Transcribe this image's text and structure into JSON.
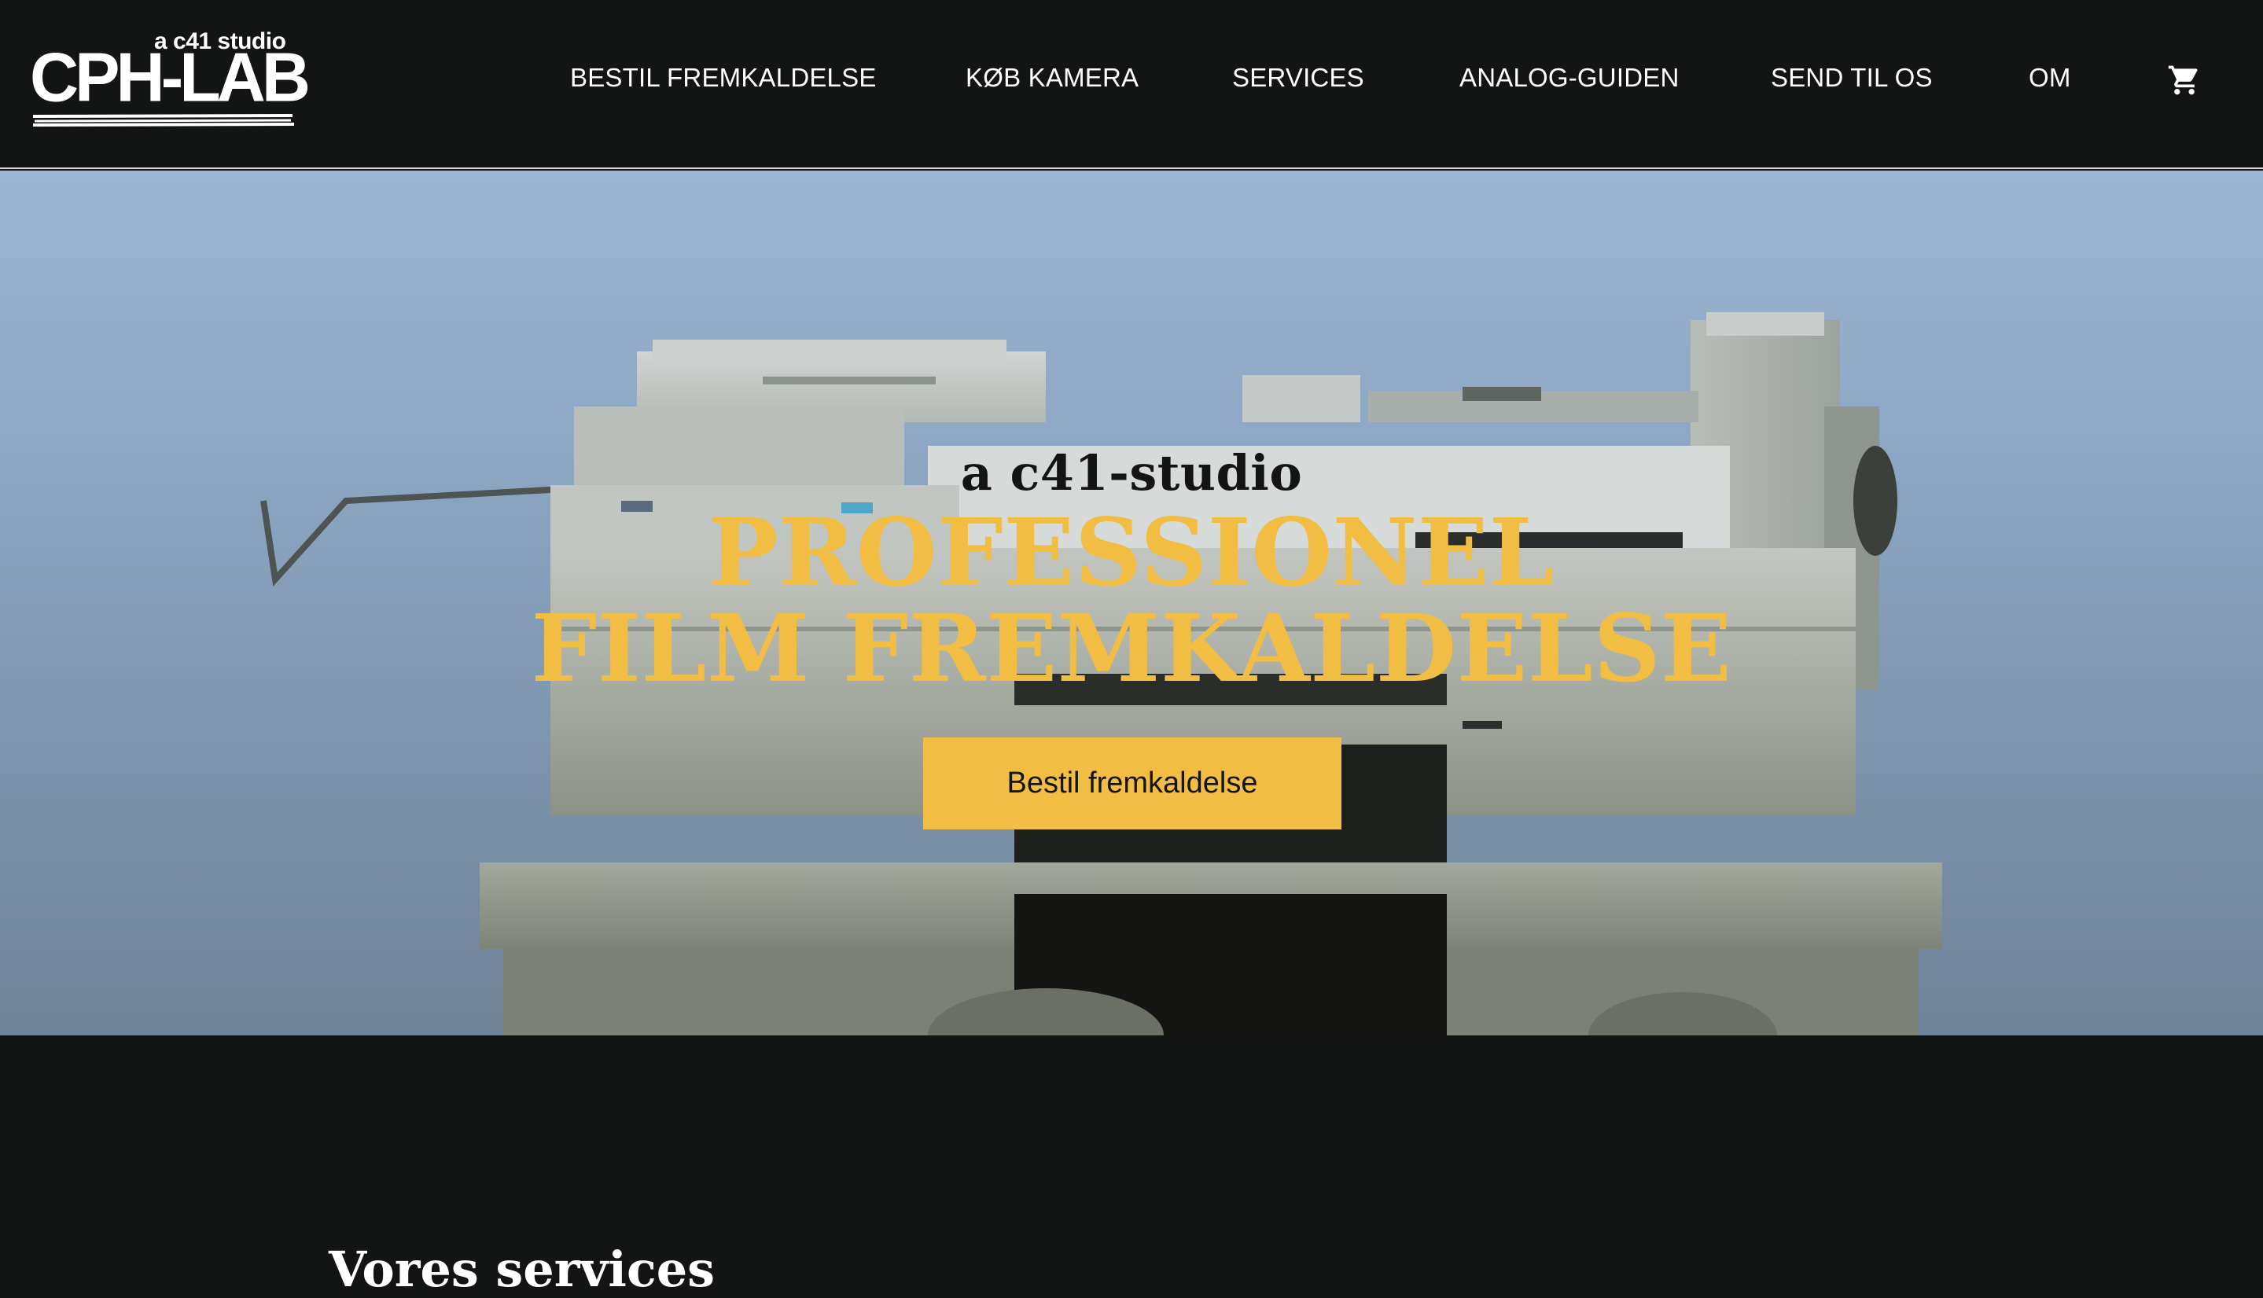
{
  "header": {
    "logo": {
      "tagline": "a c41 studio",
      "wordmark": "CPH-LAB"
    },
    "nav": [
      {
        "label": "BESTIL FREMKALDELSE"
      },
      {
        "label": "KØB KAMERA"
      },
      {
        "label": "SERVICES"
      },
      {
        "label": "ANALOG-GUIDEN"
      },
      {
        "label": "SEND TIL OS"
      },
      {
        "label": "OM"
      }
    ],
    "cart_icon": "shopping-cart-icon"
  },
  "hero": {
    "subtitle": "a c41-studio",
    "title_line1": "PROFESSIONEL",
    "title_line2": "FILM FREMKALDELSE",
    "cta_label": "Bestil fremkaldelse",
    "image": "film-processing-machine-photo"
  },
  "services": {
    "heading": "Vores services"
  },
  "colors": {
    "background": "#131514",
    "accent": "#f1bd43",
    "text_light": "#ffffff",
    "text_dark": "#141414"
  }
}
